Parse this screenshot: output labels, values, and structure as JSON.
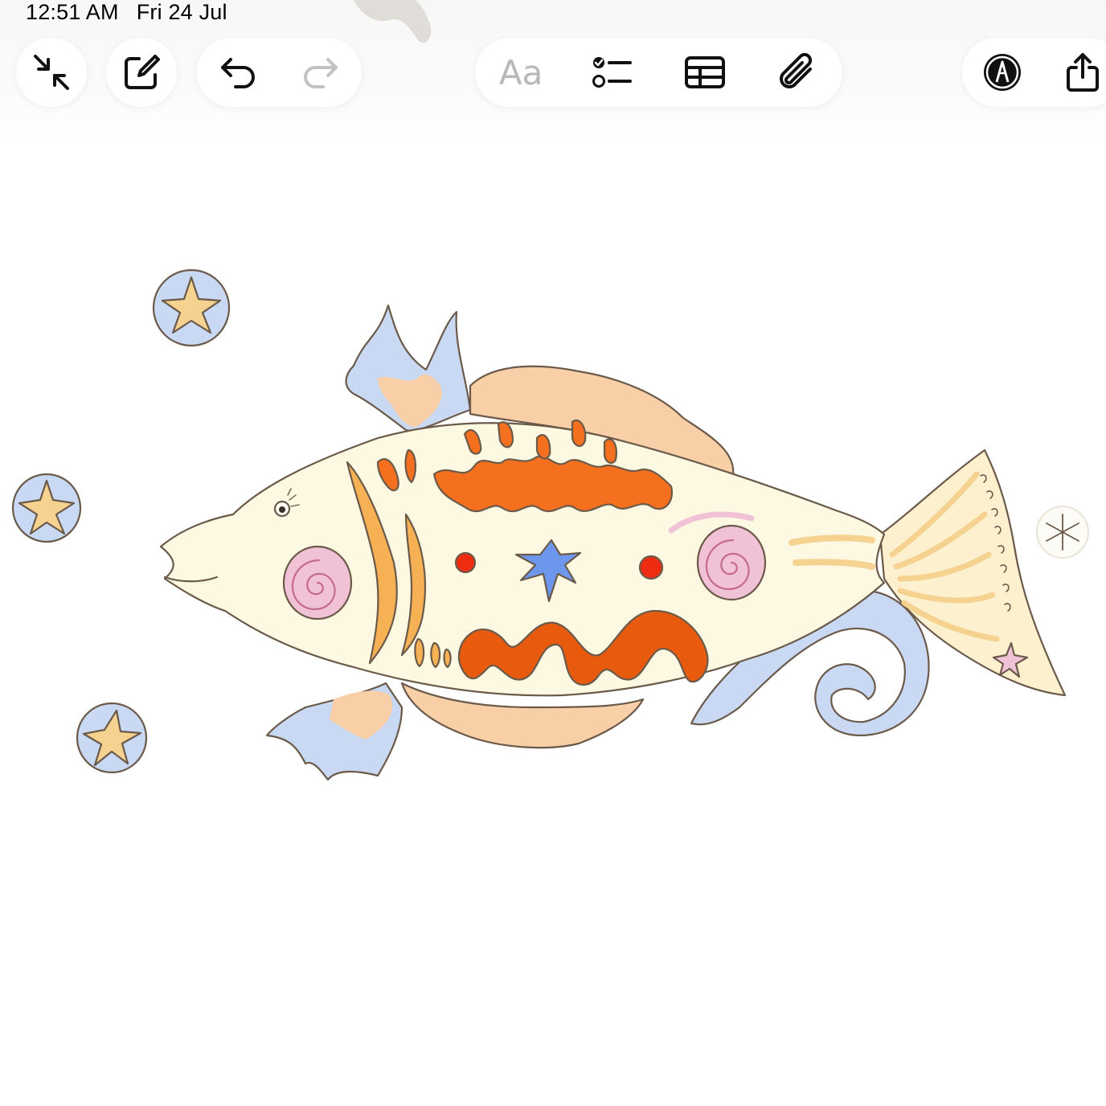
{
  "status_bar": {
    "time": "12:51 AM",
    "date": "Fri 24 Jul"
  },
  "toolbar": {
    "format_label": "Aa",
    "icons": {
      "collapse": "collapse-arrows-icon",
      "compose": "compose-note-icon",
      "undo": "undo-icon",
      "redo": "redo-icon",
      "checklist": "checklist-icon",
      "table": "table-icon",
      "attachment": "paperclip-icon",
      "markup": "markup-pen-icon",
      "share": "share-icon"
    }
  },
  "drawing": {
    "subject": "fish illustration with stars and wave",
    "colors": {
      "outline": "#6b5a4a",
      "body": "#fcf8e2",
      "fin_orange": "#f8cfa6",
      "fin_blue": "#c9d8f3",
      "pattern_orange": "#f46f1e",
      "pattern_deep": "#e85b0f",
      "swirl_pink": "#f1c2d6",
      "star_blue": "#6d97ec",
      "dot_red": "#ee2c12",
      "star_gold": "#f5d28f"
    }
  }
}
